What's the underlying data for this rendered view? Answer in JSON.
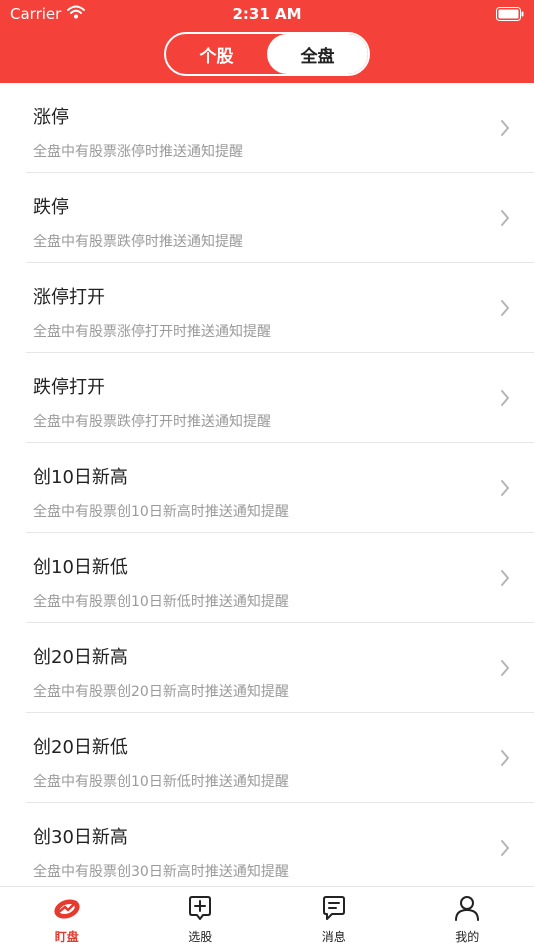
{
  "status_bar": {
    "carrier": "Carrier",
    "time": "2:31 AM"
  },
  "segment": {
    "left": "个股",
    "right": "全盘",
    "selected": "right"
  },
  "items": [
    {
      "title": "涨停",
      "desc": "全盘中有股票涨停时推送通知提醒"
    },
    {
      "title": "跌停",
      "desc": "全盘中有股票跌停时推送通知提醒"
    },
    {
      "title": "涨停打开",
      "desc": "全盘中有股票涨停打开时推送通知提醒"
    },
    {
      "title": "跌停打开",
      "desc": "全盘中有股票跌停打开时推送通知提醒"
    },
    {
      "title": "创10日新高",
      "desc": "全盘中有股票创10日新高时推送通知提醒"
    },
    {
      "title": "创10日新低",
      "desc": "全盘中有股票创10日新低时推送通知提醒"
    },
    {
      "title": "创20日新高",
      "desc": "全盘中有股票创20日新高时推送通知提醒"
    },
    {
      "title": "创20日新低",
      "desc": "全盘中有股票创10日新低时推送通知提醒"
    },
    {
      "title": "创30日新高",
      "desc": "全盘中有股票创30日新高时推送通知提醒"
    }
  ],
  "tabs": [
    {
      "label": "盯盘",
      "icon": "watch-icon",
      "active": true
    },
    {
      "label": "选股",
      "icon": "add-stock-icon",
      "active": false
    },
    {
      "label": "消息",
      "icon": "message-icon",
      "active": false
    },
    {
      "label": "我的",
      "icon": "user-icon",
      "active": false
    }
  ],
  "colors": {
    "brand": "#f4423a",
    "active_tab": "#e63a2f"
  }
}
